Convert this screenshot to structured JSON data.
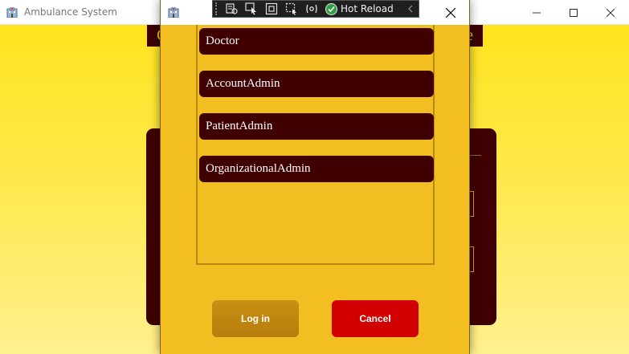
{
  "main_window": {
    "title": "Ambulance System",
    "app_icon": "hospital-icon",
    "controls": {
      "minimize": "minimize-icon",
      "maximize": "maximize-icon",
      "close": "close-icon"
    },
    "banner": {
      "left_text": "C",
      "right_text": "e"
    }
  },
  "dialog": {
    "app_icon": "hospital-icon",
    "close_icon": "close-icon",
    "roles": [
      "Doctor",
      "AccountAdmin",
      "PatientAdmin",
      "OrganizationalAdmin"
    ],
    "login_label": "Log in",
    "cancel_label": "Cancel"
  },
  "debug_toolbar": {
    "tools": [
      "live-visual-tree-icon",
      "select-element-icon",
      "display-layout-adorners-icon",
      "track-focus-icon",
      "binding-failures-icon"
    ],
    "hot_reload_label": "Hot Reload",
    "collapse_icon": "chevron-left-icon"
  },
  "colors": {
    "dialog_background": "#f2be21",
    "role_item": "#400000",
    "login_button": "#c98f12",
    "cancel_button": "#d20000",
    "gradient_top": "#ffe41f",
    "gradient_bottom": "#fff08f"
  }
}
